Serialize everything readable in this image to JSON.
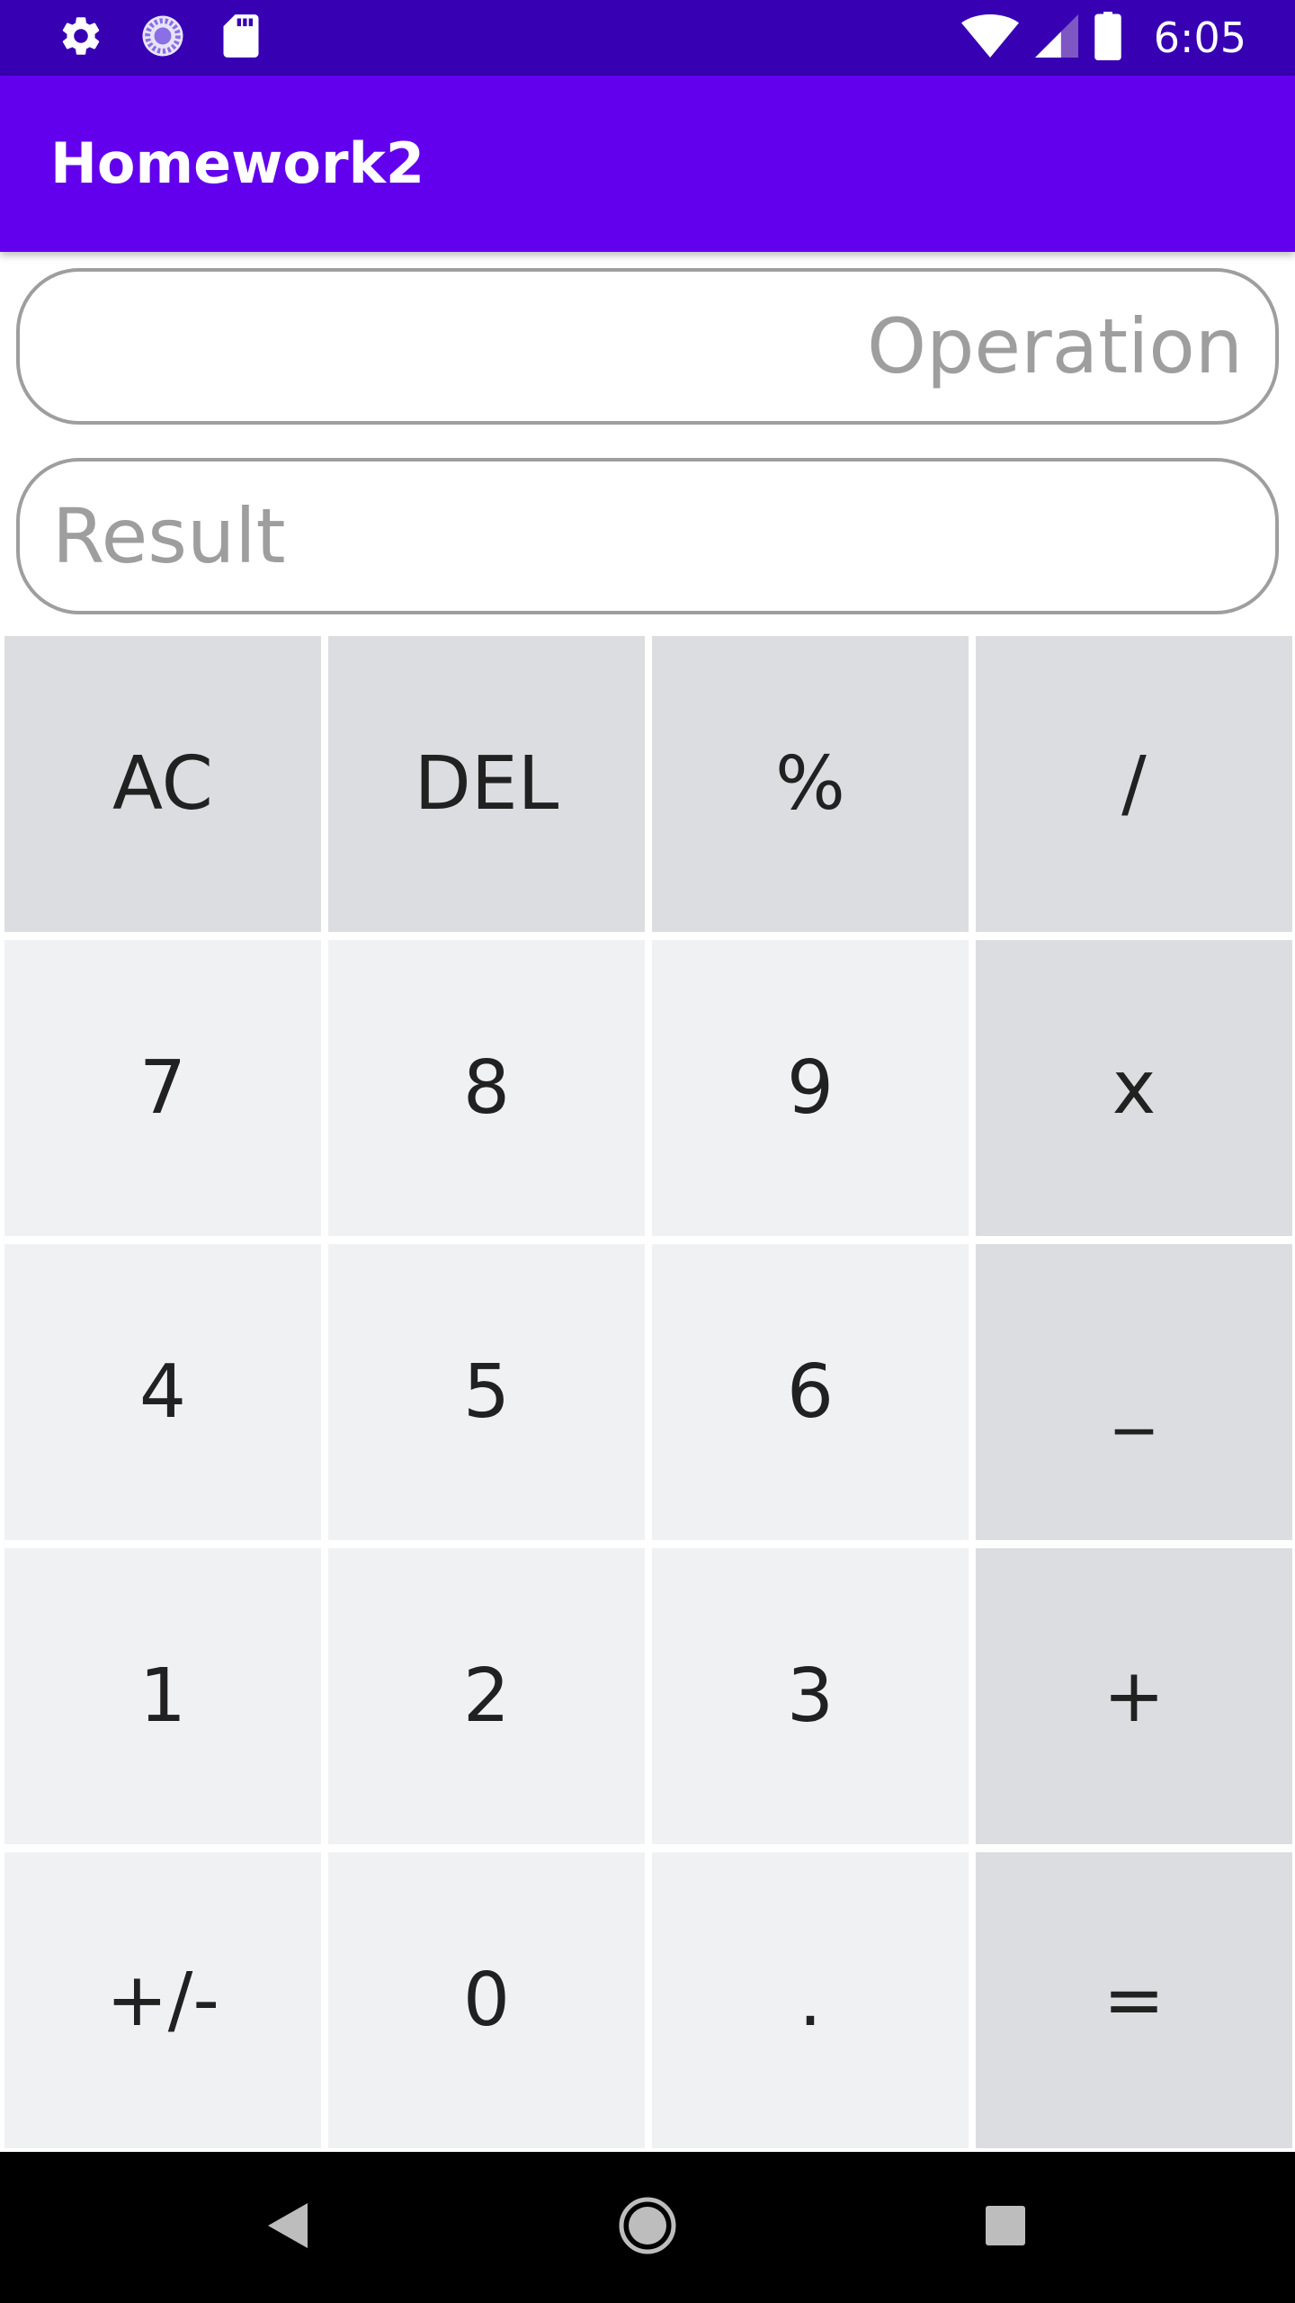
{
  "status_bar": {
    "time": "6:05",
    "left_icons": [
      "settings-gear-icon",
      "loading-spinner-icon",
      "sd-card-icon"
    ],
    "right_icons": [
      "wifi-icon",
      "cell-signal-icon",
      "battery-icon"
    ]
  },
  "app_bar": {
    "title": "Homework2"
  },
  "fields": {
    "operation": {
      "placeholder": "Operation",
      "value": ""
    },
    "result": {
      "placeholder": "Result",
      "value": ""
    }
  },
  "keypad": {
    "keys": [
      {
        "label": "AC",
        "name": "all-clear-button",
        "style": "dark"
      },
      {
        "label": "DEL",
        "name": "delete-button",
        "style": "dark"
      },
      {
        "label": "%",
        "name": "percent-button",
        "style": "dark"
      },
      {
        "label": "/",
        "name": "divide-button",
        "style": "dark"
      },
      {
        "label": "7",
        "name": "digit-7-button",
        "style": "light"
      },
      {
        "label": "8",
        "name": "digit-8-button",
        "style": "light"
      },
      {
        "label": "9",
        "name": "digit-9-button",
        "style": "light"
      },
      {
        "label": "x",
        "name": "multiply-button",
        "style": "dark"
      },
      {
        "label": "4",
        "name": "digit-4-button",
        "style": "light"
      },
      {
        "label": "5",
        "name": "digit-5-button",
        "style": "light"
      },
      {
        "label": "6",
        "name": "digit-6-button",
        "style": "light"
      },
      {
        "label": "_",
        "name": "subtract-button",
        "style": "dark"
      },
      {
        "label": "1",
        "name": "digit-1-button",
        "style": "light"
      },
      {
        "label": "2",
        "name": "digit-2-button",
        "style": "light"
      },
      {
        "label": "3",
        "name": "digit-3-button",
        "style": "light"
      },
      {
        "label": "+",
        "name": "add-button",
        "style": "dark"
      },
      {
        "label": "+/-",
        "name": "toggle-sign-button",
        "style": "light"
      },
      {
        "label": "0",
        "name": "digit-0-button",
        "style": "light"
      },
      {
        "label": ".",
        "name": "decimal-point-button",
        "style": "light"
      },
      {
        "label": "=",
        "name": "equals-button",
        "style": "dark"
      }
    ]
  },
  "nav_bar": {
    "buttons": [
      "back-triangle-icon",
      "home-circle-icon",
      "recents-square-icon"
    ]
  },
  "colors": {
    "status_bar": "#3700b3",
    "app_bar": "#6200ee",
    "key_light": "#f0f1f3",
    "key_dark": "#dcdde0",
    "placeholder_text": "#9e9e9e"
  }
}
